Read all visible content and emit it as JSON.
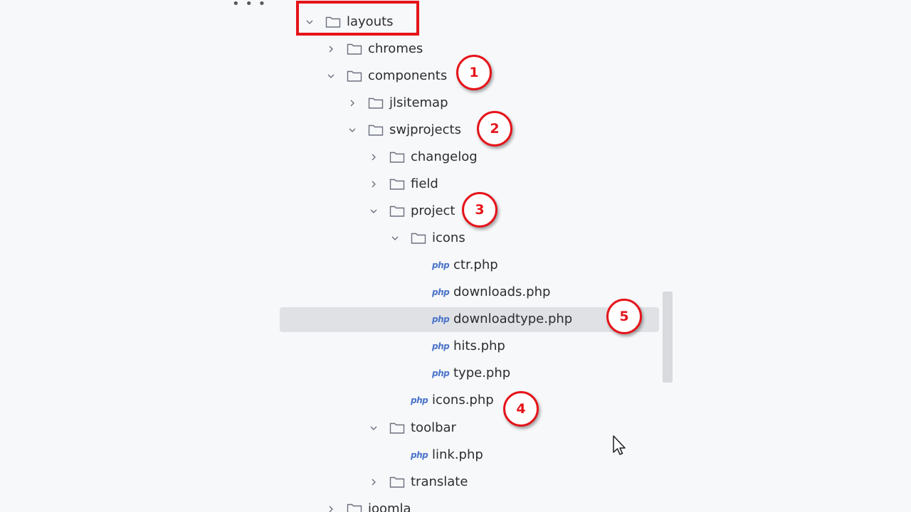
{
  "toolbar": {
    "more_icon": "more-dots-icon"
  },
  "tree": {
    "layouts": "layouts",
    "chromes": "chromes",
    "components": "components",
    "jlsitemap": "jlsitemap",
    "swjprojects": "swjprojects",
    "changelog": "changelog",
    "field": "field",
    "project": "project",
    "icons": "icons",
    "ctr": "ctr.php",
    "downloads": "downloads.php",
    "downloadtype": "downloadtype.php",
    "hits": "hits.php",
    "type": "type.php",
    "icons_php": "icons.php",
    "toolbar": "toolbar",
    "link": "link.php",
    "translate": "translate",
    "joomla": "joomla"
  },
  "file_icon_label": "php",
  "callouts": {
    "c1": "1",
    "c2": "2",
    "c3": "3",
    "c4": "4",
    "c5": "5"
  },
  "colors": {
    "background": "#f7f8fa",
    "selection": "#dfe1e5",
    "annotation_red": "#e5141a",
    "php_icon": "#4a73c9"
  }
}
